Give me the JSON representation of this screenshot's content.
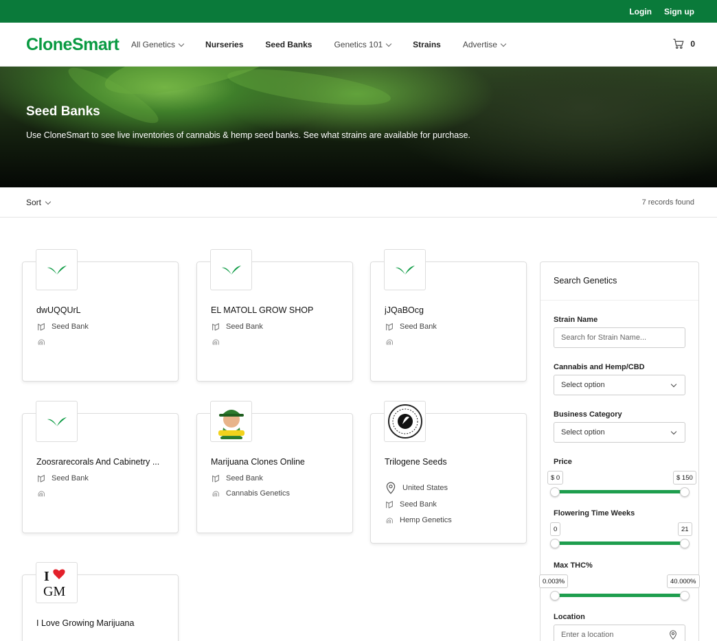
{
  "topbar": {
    "login": "Login",
    "signup": "Sign up"
  },
  "brand": {
    "logo": "CloneSmart",
    "color": "#0a9a42"
  },
  "nav": {
    "items": [
      {
        "label": "All Genetics",
        "dropdown": true
      },
      {
        "label": "Nurseries",
        "dropdown": false
      },
      {
        "label": "Seed Banks",
        "dropdown": false
      },
      {
        "label": "Genetics 101",
        "dropdown": true
      },
      {
        "label": "Strains",
        "dropdown": false
      },
      {
        "label": "Advertise",
        "dropdown": true
      }
    ],
    "cart_count": "0"
  },
  "hero": {
    "title": "Seed Banks",
    "subtitle": "Use CloneSmart to see live inventories of cannabis & hemp seed banks. See what strains are available for purchase."
  },
  "toolbar": {
    "sort_label": "Sort",
    "records": "7 records found"
  },
  "cards": [
    {
      "name": "dwUQQUrL",
      "category": "Seed Bank",
      "genetics": "",
      "location": "",
      "logo": "leaf-logo"
    },
    {
      "name": "EL MATOLL GROW SHOP",
      "category": "Seed Bank",
      "genetics": "",
      "location": "",
      "logo": "leaf-logo"
    },
    {
      "name": "jJQaBOcg",
      "category": "Seed Bank",
      "genetics": "",
      "location": "",
      "logo": "leaf-logo"
    },
    {
      "name": "Zoosrarecorals And Cabinetry ...",
      "category": "Seed Bank",
      "genetics": "",
      "location": "",
      "logo": "leaf-logo"
    },
    {
      "name": "Marijuana Clones Online",
      "category": "Seed Bank",
      "genetics": "Cannabis Genetics",
      "location": "",
      "logo": "mascot-logo"
    },
    {
      "name": "Trilogene Seeds",
      "category": "Seed Bank",
      "genetics": "Hemp Genetics",
      "location": "United States",
      "logo": "seal-logo"
    },
    {
      "name": "I Love Growing Marijuana",
      "category": "",
      "genetics": "",
      "location": "",
      "logo": "igm-logo",
      "logo_text": "I GM"
    }
  ],
  "search": {
    "title": "Search Genetics",
    "strain_label": "Strain Name",
    "strain_placeholder": "Search for Strain Name...",
    "cannabis_label": "Cannabis and Hemp/CBD",
    "cannabis_value": "Select option",
    "category_label": "Business Category",
    "category_value": "Select option",
    "price_label": "Price",
    "price_min": "$ 0",
    "price_max": "$ 150",
    "flower_label": "Flowering Time Weeks",
    "flower_min": "0",
    "flower_max": "21",
    "thc_label": "Max THC%",
    "thc_min": "0.003%",
    "thc_max": "40.000%",
    "location_label": "Location",
    "location_placeholder": "Enter a location"
  },
  "colors": {
    "topbar": "#0a7a3a",
    "accent": "#1e9e4e"
  }
}
